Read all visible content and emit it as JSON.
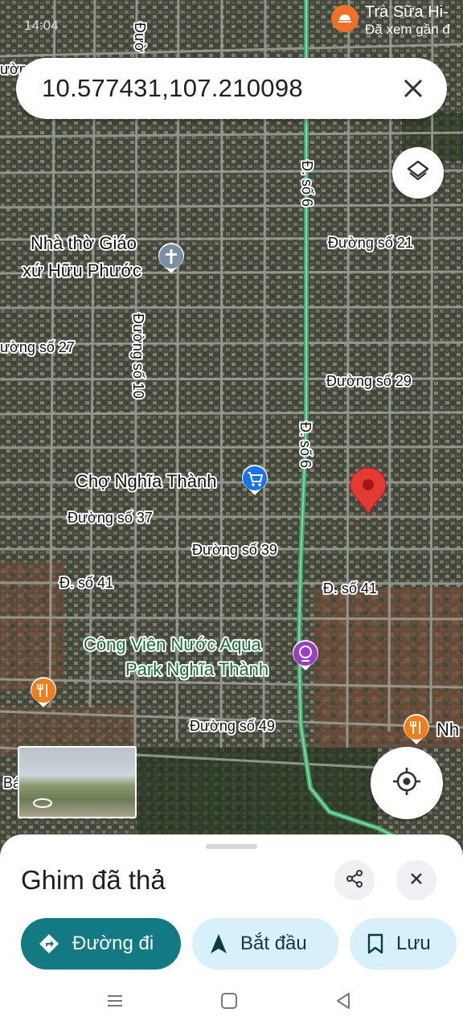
{
  "status_bar": {
    "time": "14:04"
  },
  "notification": {
    "title": "Trà Sữa Hi-",
    "subtitle": "Đã xem gần đ",
    "icon": "food-delivery-icon"
  },
  "search": {
    "query": "10.577431,107.210098",
    "clear_icon": "close-icon"
  },
  "map": {
    "pois": [
      {
        "id": "church",
        "label_lines": [
          "Nhà thờ Giáo",
          "xứ Hữu Phước"
        ],
        "icon": "church-icon"
      },
      {
        "id": "market",
        "label_lines": [
          "Chợ Nghĩa Thành"
        ],
        "icon": "shopping-cart-icon"
      },
      {
        "id": "waterpark",
        "label_lines": [
          "Công Viên Nước Aqua",
          "Park Nghĩa Thành"
        ],
        "icon": "amusement-park-icon"
      },
      {
        "id": "restaurant-right",
        "label_lines": [
          "Nh"
        ],
        "icon": "restaurant-icon"
      },
      {
        "id": "restaurant-left",
        "label_lines": [
          ""
        ],
        "icon": "restaurant-icon"
      }
    ],
    "streets": {
      "d_so_6_upper": "Đ. số 6",
      "d_so_6_lower": "Đ. số 6",
      "duong_so_10": "Đường số 10",
      "duong_so_21": "Đường số 21",
      "duong_so_27": "ường số 27",
      "duong_so_29": "Đường số 29",
      "duong_so_37": "Đường số 37",
      "duong_so_39": "Đường số 39",
      "d_so_41_left": "Đ. số 41",
      "d_so_41_right": "Đ. số 41",
      "duong_so_49": "Đường số 49",
      "top_left_fragment": "ườn",
      "top_vertical_fragment": "Đườ",
      "left_fragment": "Bá"
    },
    "dropped_pin_color": "#e53935",
    "highway_color": "#3fa86a"
  },
  "controls": {
    "layers_icon": "layers-icon",
    "locate_icon": "my-location-icon",
    "street_view_icon": "rotate-360-icon"
  },
  "sheet": {
    "title": "Ghim đã thả",
    "share_icon": "share-icon",
    "close_icon": "close-icon",
    "buttons": {
      "directions": "Đường đi",
      "start": "Bắt đầu",
      "save": "Lưu"
    }
  },
  "colors": {
    "primary": "#137a83",
    "secondary_bg": "#d7f0fa"
  }
}
